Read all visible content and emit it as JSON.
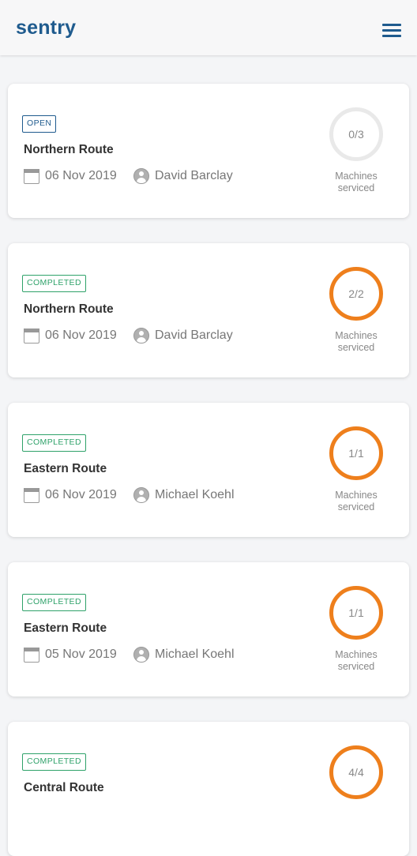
{
  "app": {
    "brand": "sentry",
    "menu_icon": "hamburger-menu-icon"
  },
  "colors": {
    "brand": "#1f5b8e",
    "open_badge": "#1f5b8e",
    "completed_badge": "#2fa26a",
    "progress_complete": "#ee7f1c",
    "progress_track": "#e9e9e9"
  },
  "routes": [
    {
      "status": "OPEN",
      "name": "Northern Route",
      "date": "06 Nov 2019",
      "technician": "David Barclay",
      "progress": "0/3",
      "progress_label": "Machines serviced"
    },
    {
      "status": "COMPLETED",
      "name": "Northern Route",
      "date": "06 Nov 2019",
      "technician": "David Barclay",
      "progress": "2/2",
      "progress_label": "Machines serviced"
    },
    {
      "status": "COMPLETED",
      "name": "Eastern Route",
      "date": "06 Nov 2019",
      "technician": "Michael Koehl",
      "progress": "1/1",
      "progress_label": "Machines serviced"
    },
    {
      "status": "COMPLETED",
      "name": "Eastern Route",
      "date": "05 Nov 2019",
      "technician": "Michael Koehl",
      "progress": "1/1",
      "progress_label": "Machines serviced"
    },
    {
      "status": "COMPLETED",
      "name": "Central Route",
      "date": "",
      "technician": "",
      "progress": "4/4",
      "progress_label": ""
    }
  ]
}
